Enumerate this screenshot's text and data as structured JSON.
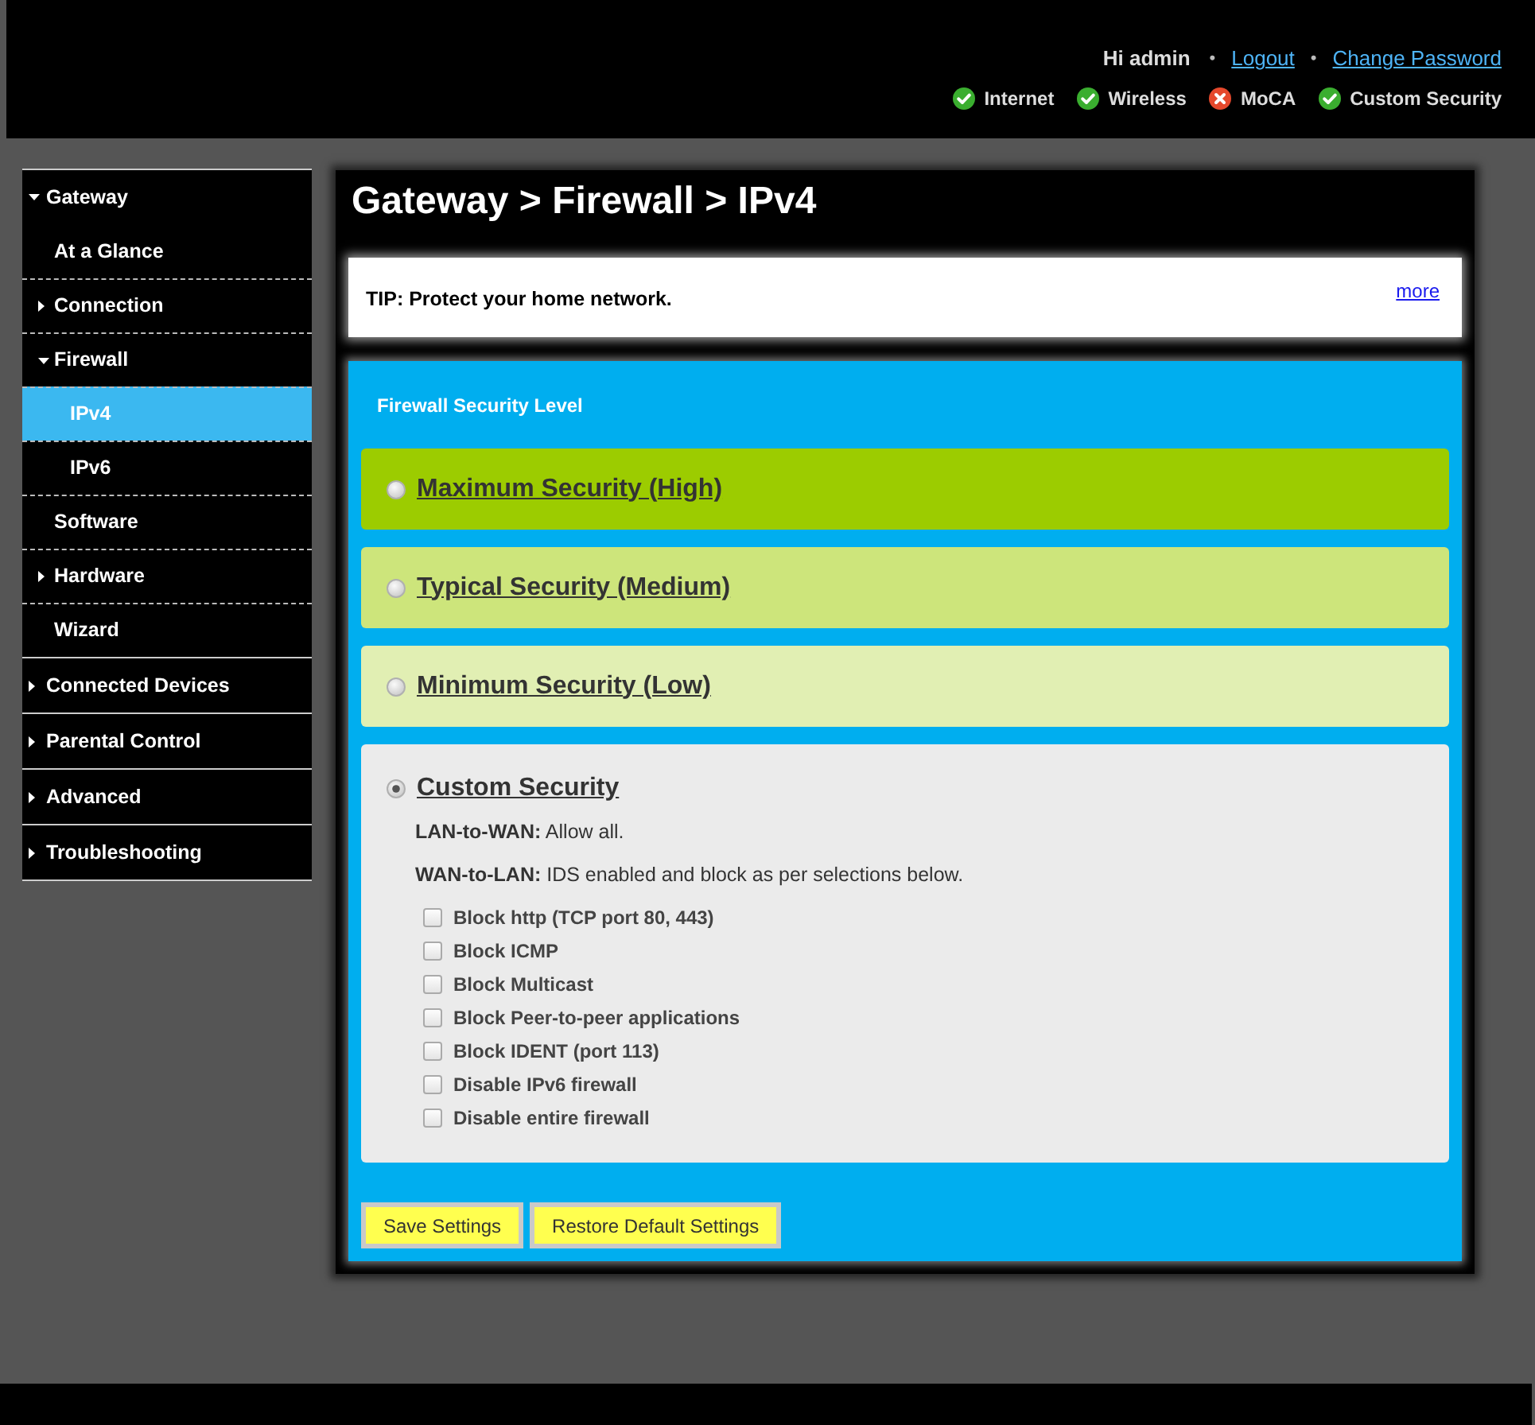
{
  "header": {
    "user_menu": [
      {
        "kind": "text",
        "label": "Hi admin"
      },
      {
        "kind": "separator",
        "label": "•"
      },
      {
        "kind": "link",
        "label": "Logout"
      },
      {
        "kind": "separator",
        "label": "•"
      },
      {
        "kind": "link",
        "label": "Change Password"
      }
    ],
    "statuses": [
      {
        "label": "Internet",
        "ok": true
      },
      {
        "label": "Wireless",
        "ok": true
      },
      {
        "label": "MoCA",
        "ok": false
      },
      {
        "label": "Custom Security",
        "ok": true
      }
    ]
  },
  "sidebar": {
    "items": [
      {
        "kind": "folder",
        "label": "Gateway",
        "expanded": true,
        "selected": false,
        "children": [
          {
            "kind": "page",
            "label": "At a Glance",
            "selected": false
          },
          {
            "kind": "folder",
            "label": "Connection",
            "expanded": false,
            "selected": false
          },
          {
            "kind": "folder",
            "label": "Firewall",
            "expanded": true,
            "selected": false,
            "children": [
              {
                "kind": "page",
                "label": "IPv4",
                "selected": true
              },
              {
                "kind": "page",
                "label": "IPv6",
                "selected": false
              }
            ]
          },
          {
            "kind": "page",
            "label": "Software",
            "selected": false
          },
          {
            "kind": "folder",
            "label": "Hardware",
            "expanded": false,
            "selected": false
          },
          {
            "kind": "page",
            "label": "Wizard",
            "selected": false
          }
        ]
      },
      {
        "kind": "folder",
        "label": "Connected Devices",
        "expanded": false,
        "selected": false
      },
      {
        "kind": "folder",
        "label": "Parental Control",
        "expanded": false,
        "selected": false
      },
      {
        "kind": "folder",
        "label": "Advanced",
        "expanded": false,
        "selected": false
      },
      {
        "kind": "folder",
        "label": "Troubleshooting",
        "expanded": false,
        "selected": false
      }
    ]
  },
  "page_title": "Gateway > Firewall > IPv4",
  "tip": {
    "text": "TIP: Protect your home network.",
    "link": "more"
  },
  "firewall": {
    "heading": "Firewall Security Level",
    "levels": [
      {
        "kind": "preset",
        "label": "Maximum Security (High)",
        "color": "#9ccc00",
        "selected": false
      },
      {
        "kind": "preset",
        "label": "Typical Security (Medium)",
        "color": "#cde57b",
        "selected": false
      },
      {
        "kind": "preset",
        "label": "Minimum Security (Low)",
        "color": "#e1efb3",
        "selected": false
      },
      {
        "kind": "custom",
        "label": "Custom Security",
        "color": "#ebebeb",
        "selected": true,
        "details": [
          "**LAN-to-WAN:** Allow all.",
          "**WAN-to-LAN:** IDS enabled and block as per selections below."
        ],
        "options": [
          {
            "label": "Block http (TCP port 80, 443)",
            "checked": false
          },
          {
            "label": "Block ICMP",
            "checked": false
          },
          {
            "label": "Block Multicast",
            "checked": false
          },
          {
            "label": "Block Peer-to-peer applications",
            "checked": false
          },
          {
            "label": "Block IDENT (port 113)",
            "checked": false
          },
          {
            "label": "Disable IPv6 firewall",
            "checked": false
          },
          {
            "label": "Disable entire firewall",
            "checked": false
          }
        ]
      }
    ]
  },
  "buttons": [
    "Save Settings",
    "Restore Default Settings"
  ]
}
